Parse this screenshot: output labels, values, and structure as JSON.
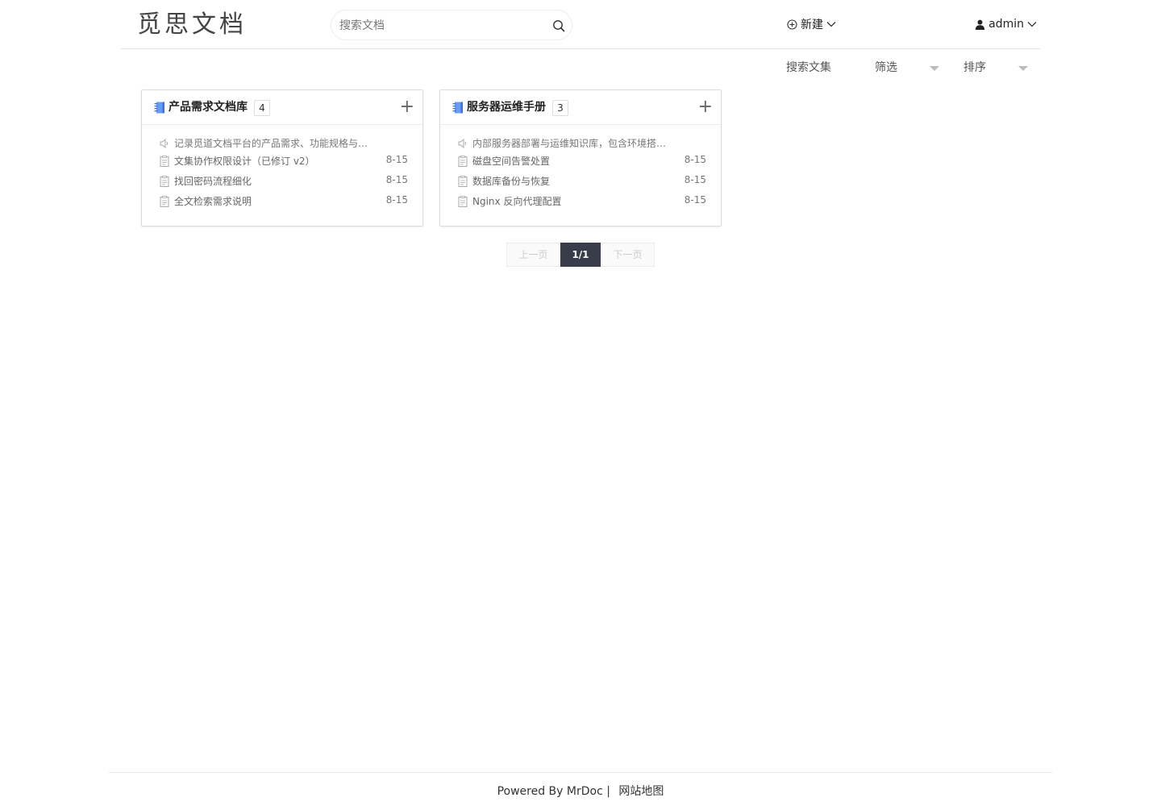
{
  "header": {
    "logo": "觅思文档",
    "search_placeholder": "搜索文档",
    "new_label": "新建",
    "user_label": "admin"
  },
  "toolbar": {
    "search_label": "搜索文集",
    "filter_label": "筛选",
    "sort_label": "排序"
  },
  "collections": [
    {
      "title": "产品需求文档库",
      "count": "4",
      "intro": "记录觅道文档平台的产品需求、功能规格与迭...",
      "docs": [
        {
          "title": "文集协作权限设计（已修订 v2）",
          "date": "8-15"
        },
        {
          "title": "找回密码流程细化",
          "date": "8-15"
        },
        {
          "title": "全文检索需求说明",
          "date": "8-15"
        }
      ]
    },
    {
      "title": "服务器运维手册",
      "count": "3",
      "intro": "内部服务器部署与运维知识库，包含环境搭建...",
      "docs": [
        {
          "title": "磁盘空间告警处置",
          "date": "8-15"
        },
        {
          "title": "数据库备份与恢复",
          "date": "8-15"
        },
        {
          "title": "Nginx 反向代理配置",
          "date": "8-15"
        }
      ]
    }
  ],
  "pagination": {
    "prev": "上一页",
    "current": "1/1",
    "next": "下一页"
  },
  "footer": {
    "powered": "Powered By",
    "brand": "MrDoc",
    "separator": "|",
    "sitemap": "网站地图"
  },
  "colors": {
    "accent_dark": "#393D49",
    "book_icon_blue": "#6a9bf4"
  }
}
